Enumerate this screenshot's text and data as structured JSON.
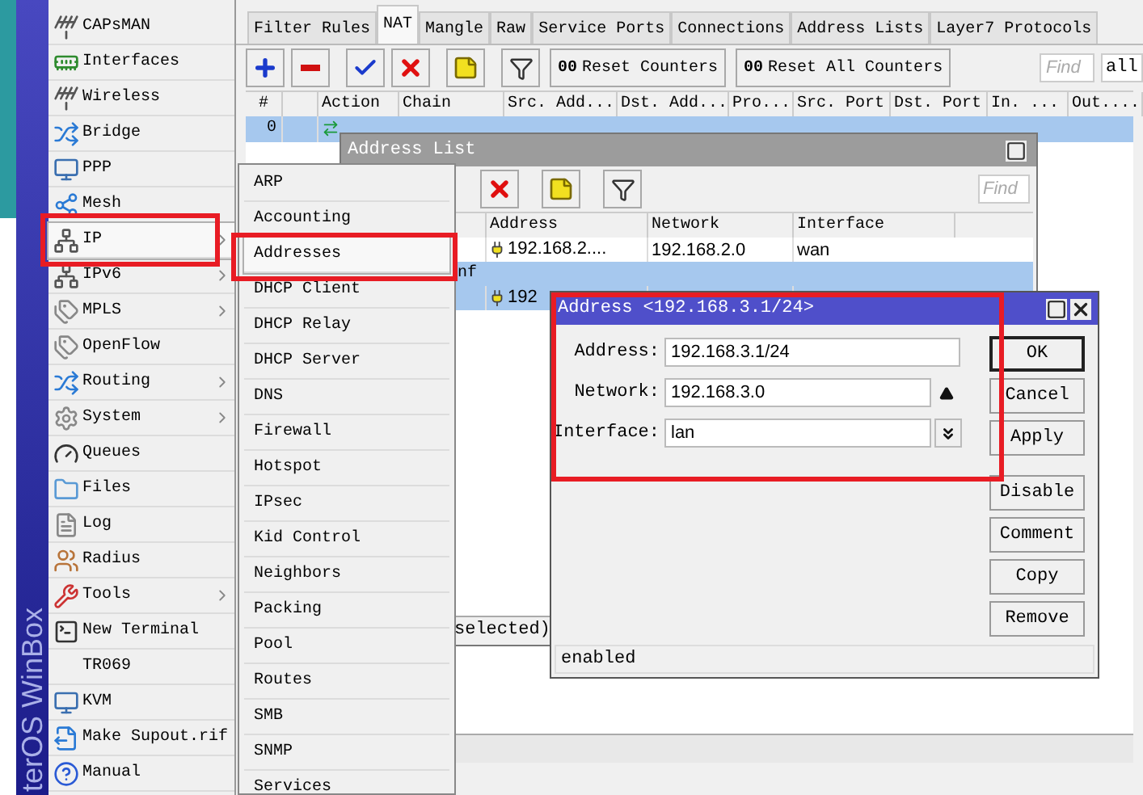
{
  "sidebar": {
    "brand": "terOS WinBox",
    "items": [
      {
        "label": "CAPsMAN",
        "submenu": false,
        "selected": false
      },
      {
        "label": "Interfaces",
        "submenu": false,
        "selected": false
      },
      {
        "label": "Wireless",
        "submenu": false,
        "selected": false
      },
      {
        "label": "Bridge",
        "submenu": false,
        "selected": false
      },
      {
        "label": "PPP",
        "submenu": false,
        "selected": false
      },
      {
        "label": "Mesh",
        "submenu": false,
        "selected": false
      },
      {
        "label": "IP",
        "submenu": true,
        "selected": true
      },
      {
        "label": "IPv6",
        "submenu": true,
        "selected": false
      },
      {
        "label": "MPLS",
        "submenu": true,
        "selected": false
      },
      {
        "label": "OpenFlow",
        "submenu": false,
        "selected": false
      },
      {
        "label": "Routing",
        "submenu": true,
        "selected": false
      },
      {
        "label": "System",
        "submenu": true,
        "selected": false
      },
      {
        "label": "Queues",
        "submenu": false,
        "selected": false
      },
      {
        "label": "Files",
        "submenu": false,
        "selected": false
      },
      {
        "label": "Log",
        "submenu": false,
        "selected": false
      },
      {
        "label": "Radius",
        "submenu": false,
        "selected": false
      },
      {
        "label": "Tools",
        "submenu": true,
        "selected": false
      },
      {
        "label": "New Terminal",
        "submenu": false,
        "selected": false
      },
      {
        "label": "TR069",
        "submenu": false,
        "selected": false
      },
      {
        "label": "KVM",
        "submenu": false,
        "selected": false
      },
      {
        "label": "Make Supout.rif",
        "submenu": false,
        "selected": false
      },
      {
        "label": "Manual",
        "submenu": false,
        "selected": false
      }
    ]
  },
  "firewall": {
    "tabs": [
      {
        "label": "Filter Rules",
        "selected": false
      },
      {
        "label": "NAT",
        "selected": true
      },
      {
        "label": "Mangle",
        "selected": false
      },
      {
        "label": "Raw",
        "selected": false
      },
      {
        "label": "Service Ports",
        "selected": false
      },
      {
        "label": "Connections",
        "selected": false
      },
      {
        "label": "Address Lists",
        "selected": false
      },
      {
        "label": "Layer7 Protocols",
        "selected": false
      }
    ],
    "counter_buttons": [
      {
        "icon": "00",
        "label": "Reset Counters"
      },
      {
        "icon": "00",
        "label": "Reset All Counters"
      }
    ],
    "find_placeholder": "Find",
    "filter_value": "all",
    "columns": [
      "#",
      "",
      "Action",
      "Chain",
      "Src. Add...",
      "Dst. Add...",
      "Pro...",
      "Src. Port",
      "Dst. Port",
      "In. ...",
      "Out...."
    ],
    "rows": [
      {
        "number": "0",
        "selected": true
      }
    ]
  },
  "ip_menu": {
    "items": [
      {
        "label": "ARP",
        "selected": false
      },
      {
        "label": "Accounting",
        "selected": false
      },
      {
        "label": "Addresses",
        "selected": true
      },
      {
        "label": "DHCP Client",
        "selected": false
      },
      {
        "label": "DHCP Relay",
        "selected": false
      },
      {
        "label": "DHCP Server",
        "selected": false
      },
      {
        "label": "DNS",
        "selected": false
      },
      {
        "label": "Firewall",
        "selected": false
      },
      {
        "label": "Hotspot",
        "selected": false
      },
      {
        "label": "IPsec",
        "selected": false
      },
      {
        "label": "Kid Control",
        "selected": false
      },
      {
        "label": "Neighbors",
        "selected": false
      },
      {
        "label": "Packing",
        "selected": false
      },
      {
        "label": "Pool",
        "selected": false
      },
      {
        "label": "Routes",
        "selected": false
      },
      {
        "label": "SMB",
        "selected": false
      },
      {
        "label": "SNMP",
        "selected": false
      },
      {
        "label": "Services",
        "selected": false
      }
    ]
  },
  "address_list": {
    "title": "Address List",
    "find_placeholder": "Find",
    "columns": [
      "Address",
      "Network",
      "Interface"
    ],
    "rows": [
      {
        "kind": "address",
        "address": "192.168.2....",
        "network": "192.168.2.0",
        "interface": "wan",
        "selected": false
      },
      {
        "kind": "comment",
        "text": "nf",
        "selected": true
      },
      {
        "kind": "address",
        "address": "192",
        "network": "",
        "interface": "",
        "selected": true
      }
    ],
    "status": "selected)"
  },
  "address_dialog": {
    "title": "Address <192.168.3.1/24>",
    "fields": [
      {
        "kind": "text",
        "label": "Address:",
        "value": "192.168.3.1/24"
      },
      {
        "kind": "spinner",
        "label": "Network:",
        "value": "192.168.3.0"
      },
      {
        "kind": "dropdown",
        "label": "Interface:",
        "value": "lan"
      }
    ],
    "buttons": [
      {
        "label": "OK",
        "default": true
      },
      {
        "label": "Cancel",
        "default": false
      },
      {
        "label": "Apply",
        "default": false
      },
      {
        "label": "Disable",
        "default": false
      },
      {
        "label": "Comment",
        "default": false
      },
      {
        "label": "Copy",
        "default": false
      },
      {
        "label": "Remove",
        "default": false
      }
    ],
    "status": "enabled"
  }
}
